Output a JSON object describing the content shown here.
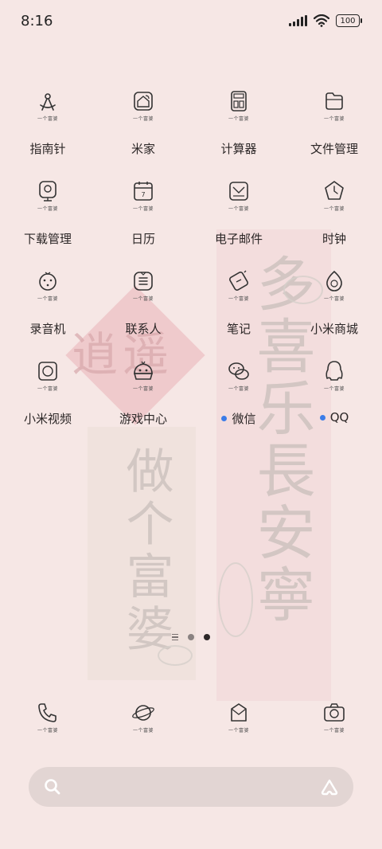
{
  "status_bar": {
    "time": "8:16",
    "battery": "100"
  },
  "tagline": "一个富婆",
  "apps": [
    {
      "label": "指南针",
      "icon": "compass-icon"
    },
    {
      "label": "米家",
      "icon": "smart-home-icon"
    },
    {
      "label": "计算器",
      "icon": "calculator-icon"
    },
    {
      "label": "文件管理",
      "icon": "folder-icon"
    },
    {
      "label": "下载管理",
      "icon": "download-icon"
    },
    {
      "label": "日历",
      "icon": "calendar-icon",
      "badge": "7"
    },
    {
      "label": "电子邮件",
      "icon": "mail-icon"
    },
    {
      "label": "时钟",
      "icon": "clock-icon"
    },
    {
      "label": "录音机",
      "icon": "recorder-icon"
    },
    {
      "label": "联系人",
      "icon": "contacts-icon"
    },
    {
      "label": "笔记",
      "icon": "notes-icon"
    },
    {
      "label": "小米商城",
      "icon": "mi-store-icon"
    },
    {
      "label": "小米视频",
      "icon": "video-icon"
    },
    {
      "label": "游戏中心",
      "icon": "game-center-icon"
    },
    {
      "label": "微信",
      "icon": "wechat-icon",
      "new": true
    },
    {
      "label": "QQ",
      "icon": "qq-icon",
      "new": true
    }
  ],
  "dock": [
    {
      "icon": "phone-icon"
    },
    {
      "icon": "browser-icon"
    },
    {
      "icon": "messages-icon"
    },
    {
      "icon": "camera-icon"
    }
  ],
  "pager": {
    "pages": 2,
    "active": 2
  },
  "wallpaper": {
    "left_text": "做个富婆",
    "right_text": "多喜乐長安寧",
    "seal_text": "逍遥"
  },
  "colors": {
    "background": "#f6e7e5",
    "accent_dot": "#3b7ce8",
    "text": "#2c2727"
  }
}
